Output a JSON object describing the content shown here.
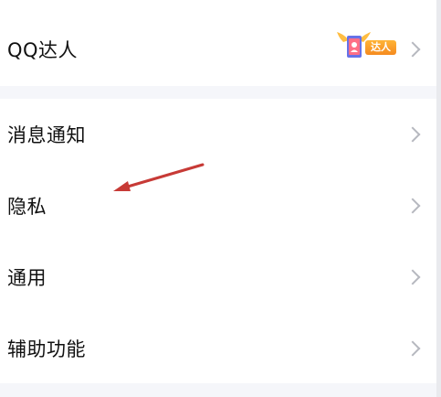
{
  "settings": {
    "qq_expert": {
      "label": "QQ达人",
      "badge_text": "达人"
    },
    "items": [
      {
        "label": "消息通知"
      },
      {
        "label": "隐私"
      },
      {
        "label": "通用"
      },
      {
        "label": "辅助功能"
      }
    ]
  },
  "colors": {
    "background": "#f5f6fa",
    "row_background": "#ffffff",
    "chevron": "#b6b8bf",
    "badge_orange": "#f58a1f",
    "annotation_arrow": "#c73a36"
  },
  "icons": {
    "chevron": "chevron-right-icon",
    "badge": "qq-expert-badge-icon",
    "annotation": "red-arrow-annotation"
  }
}
